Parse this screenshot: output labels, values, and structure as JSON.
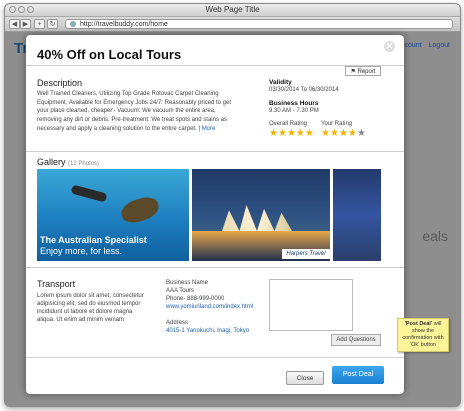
{
  "window": {
    "title": "Web Page Title",
    "url": "http://travelbuddy.com/home"
  },
  "background": {
    "logo": "Tr",
    "links": [
      "ccount",
      "Logout"
    ],
    "deals_text": "eals"
  },
  "modal": {
    "title": "40% Off on Local Tours",
    "report_label": "Report",
    "description": {
      "heading": "Description",
      "text": "Well Trained Cleaners, Utilizing Top Grade Rotovac Carpet Cleaning Equipment, Available for Emergency Jobs 24/7: Reasonably priced to get your place cleaned, cheaper'- Vacuum: We vacuum the entire area, removing any dirt or debris. Pre-treatment: We treat spots and stains as necessary and apply a cleaning solution to the entire carpet.",
      "more_link": "More"
    },
    "validity": {
      "label": "Validity",
      "value": "03/30/2014 To 06/30/2014"
    },
    "hours": {
      "label": "Business Hours",
      "value": "9.30 AM - 7.30 PM"
    },
    "ratings": {
      "overall_label": "Overall Rating",
      "overall_stars": 5,
      "your_label": "Your Rating",
      "your_stars": 4,
      "max": 5
    },
    "gallery": {
      "heading": "Gallery",
      "count": "(12 Photos)",
      "photo1_caption1": "The Australian Specialist",
      "photo1_caption2": "Enjoy more, for less.",
      "photo2_logo": "Harpers Travel"
    },
    "transport": {
      "heading": "Transport",
      "text": "Lorem ipsum dolor sit amet, consectetur adipisicing elit, sed do eiusmod tempor incididunt ut labore et dolore magna aliqua. Ut enim ad minim veniam"
    },
    "business": {
      "name_label": "Business Name",
      "name": "AAA Tours",
      "phone": "Phone- 888-999-0000",
      "website": "www.yomiuriland.com/index.html",
      "address_label": "Address",
      "address": "4015-1 Yanokuchi, Inagi, Tokyo"
    },
    "add_questions_label": "Add Questions",
    "close_label": "Close",
    "post_label": "Post Deal"
  },
  "sticky_note": {
    "text_bold": "'Post Deal'",
    "text_rest": " will show the confirmation with 'Ok' button"
  },
  "colors": {
    "accent": "#1f8ad8",
    "link": "#1f5fb3",
    "star": "#f0b400"
  }
}
